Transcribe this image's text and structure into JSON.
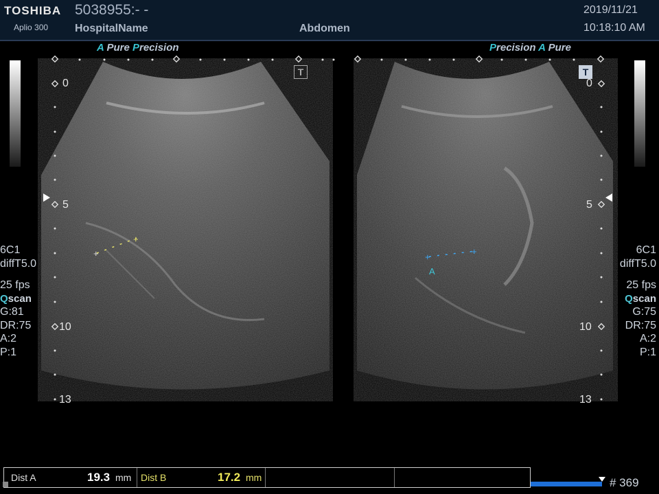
{
  "header": {
    "brand": "TOSHIBA",
    "model": "Aplio 300",
    "patient_id": "5038955:- -",
    "hospital": "HospitalName",
    "exam": "Abdomen",
    "date": "2019/11/21",
    "time": "10:18:10 AM"
  },
  "left_image": {
    "mode_a": "A",
    "mode_pure": "Pure",
    "mode_p": "P",
    "mode_recision": "recision",
    "depth_0": "0",
    "depth_5": "5",
    "depth_10": "10",
    "depth_13": "13",
    "t_label": "T",
    "params": {
      "probe": "6C1",
      "freq": "diffT5.0",
      "fps": "25 fps",
      "q": "Q",
      "scan": "scan",
      "gain": "G:81",
      "dr": "DR:75",
      "a": "A:2",
      "p": "P:1"
    }
  },
  "right_image": {
    "mode_p": "P",
    "mode_recision": "recision",
    "mode_a": "A",
    "mode_pure": "Pure",
    "depth_0": "0",
    "depth_5": "5",
    "depth_10": "10",
    "depth_13": "13",
    "t_label": "T",
    "caliper_label": "A",
    "params": {
      "probe": "6C1",
      "freq": "diffT5.0",
      "fps": "25 fps",
      "q": "Q",
      "scan": "scan",
      "gain": "G:75",
      "dr": "DR:75",
      "a": "A:2",
      "p": "P:1"
    }
  },
  "measurements": {
    "dist_a_label": "Dist A",
    "dist_a_value": "19.3",
    "dist_a_unit": "mm",
    "dist_b_label": "Dist B",
    "dist_b_value": "17.2",
    "dist_b_unit": "mm"
  },
  "footer": {
    "frame_count": "# 369"
  },
  "colors": {
    "header_bg": "#0b1a2a",
    "caliper_a": "#3fa9f5",
    "caliper_b": "#e6e26a",
    "accent_cyan": "#38c2d0",
    "progress": "#1e6fd8"
  }
}
